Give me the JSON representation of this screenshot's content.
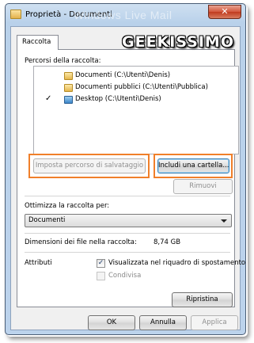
{
  "window": {
    "title": "Proprietà - Documenti",
    "watermark": "Windows Live Mail",
    "logo": "GEEKISSIMO",
    "close_symbol": "✕"
  },
  "tabs": [
    {
      "label": "Raccolta",
      "active": true
    }
  ],
  "library": {
    "paths_label": "Percorsi della raccolta:",
    "items": [
      {
        "label": "Documenti (C:\\Utenti\\Denis)",
        "icon": "folder-icon",
        "checked": false
      },
      {
        "label": "Documenti pubblici (C:\\Utenti\\Pubblica)",
        "icon": "folder-icon",
        "checked": false
      },
      {
        "label": "Desktop (C:\\Utenti\\Denis)",
        "icon": "desktop-folder-icon",
        "checked": true
      }
    ],
    "check_symbol": "✓",
    "buttons": {
      "set_save_location": "Imposta percorso di salvataggio",
      "include_folder": "Includi una cartella...",
      "remove": "Rimuovi"
    }
  },
  "optimize": {
    "label": "Ottimizza la raccolta per:",
    "selected": "Documenti"
  },
  "size": {
    "label": "Dimensioni dei file nella raccolta:",
    "value": "8,74 GB"
  },
  "attributes": {
    "label": "Attributi",
    "show_in_nav": {
      "label": "Visualizzata nel riquadro di spostamento",
      "checked": true
    },
    "shared": {
      "label": "Condivisa",
      "checked": false
    }
  },
  "restore_button": "Ripristina",
  "footer": {
    "ok": "OK",
    "cancel": "Annulla",
    "apply": "Applica"
  },
  "colors": {
    "highlight": "#f07f2a",
    "close": "#c8452a",
    "frame": "#bcd3ec"
  }
}
